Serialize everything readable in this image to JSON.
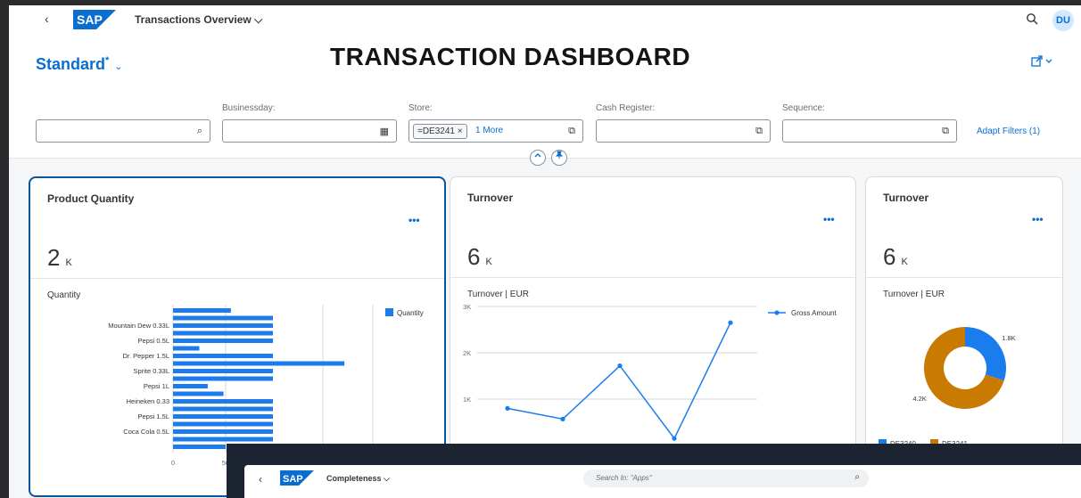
{
  "shell": {
    "back_label": "‹",
    "logo_text": "SAP",
    "app_title": "Transactions Overview ⌵",
    "user_initials": "DU"
  },
  "header": {
    "variant_name": "Standard",
    "variant_modified": "*",
    "variant_chevron": "⌄",
    "dashboard_title": "TRANSACTION DASHBOARD",
    "share_icon": "share-icon"
  },
  "filters": [
    {
      "label": "",
      "value": "",
      "icon": "⌕"
    },
    {
      "label": "Businessday:",
      "value": "",
      "icon": "▦"
    },
    {
      "label": "Store:",
      "token": "=DE3241",
      "token_close": "×",
      "more": "1 More",
      "icon": "⧉"
    },
    {
      "label": "Cash Register:",
      "value": "",
      "icon": "⧉"
    },
    {
      "label": "Sequence:",
      "value": "",
      "icon": "⧉"
    }
  ],
  "adapt_filters": "Adapt Filters (1)",
  "cards": [
    {
      "title": "Product Quantity",
      "menu": "•••",
      "kpi_value": "2",
      "kpi_unit": "K",
      "chart_subtitle": "Quantity"
    },
    {
      "title": "Turnover",
      "menu": "•••",
      "kpi_value": "6",
      "kpi_unit": "K",
      "chart_subtitle": "Turnover | EUR"
    },
    {
      "title": "Turnover",
      "menu": "•••",
      "kpi_value": "6",
      "kpi_unit": "K",
      "chart_subtitle": "Turnover | EUR"
    }
  ],
  "chart_data": [
    {
      "type": "bar",
      "orientation": "horizontal",
      "categories": [
        "",
        "",
        "Mountain Dew 0.33L",
        "",
        "Pepsi 0.5L",
        "",
        "Dr. Pepper 1.5L",
        "",
        "Sprite 0.33L",
        "",
        "Pepsi 1L",
        "",
        "Heineken 0.33",
        "",
        "Pepsi 1.5L",
        "",
        "Coca Cola 0.5L",
        "",
        ""
      ],
      "series": [
        {
          "name": "Quantity",
          "values": [
            55,
            95,
            95,
            95,
            95,
            25,
            95,
            163,
            95,
            95,
            33,
            48,
            95,
            95,
            95,
            95,
            95,
            95,
            50
          ]
        }
      ],
      "x_ticks": [
        "0",
        "50"
      ],
      "legend": "top-right",
      "color": "#1b7cee"
    },
    {
      "type": "line",
      "y_ticks": [
        "3K",
        "2K",
        "1K"
      ],
      "ylim": [
        0,
        3000
      ],
      "series": [
        {
          "name": "Gross Amount",
          "values": [
            800,
            570,
            1720,
            150,
            2650
          ]
        }
      ],
      "legend": "top-right",
      "color": "#1b7cee"
    },
    {
      "type": "pie",
      "variant": "donut",
      "slices": [
        {
          "name": "DE3240",
          "value": 1.8,
          "label": "1.8K",
          "color": "#1b7cee"
        },
        {
          "name": "DE3241",
          "value": 4.2,
          "label": "4.2K",
          "color": "#c87b00"
        }
      ],
      "legend": "bottom"
    }
  ],
  "overlay": {
    "back_label": "‹",
    "logo_text": "SAP",
    "app_title": "Completeness ⌵",
    "search_placeholder": "Search In: \"Apps\"",
    "search_icon": "⌕"
  }
}
